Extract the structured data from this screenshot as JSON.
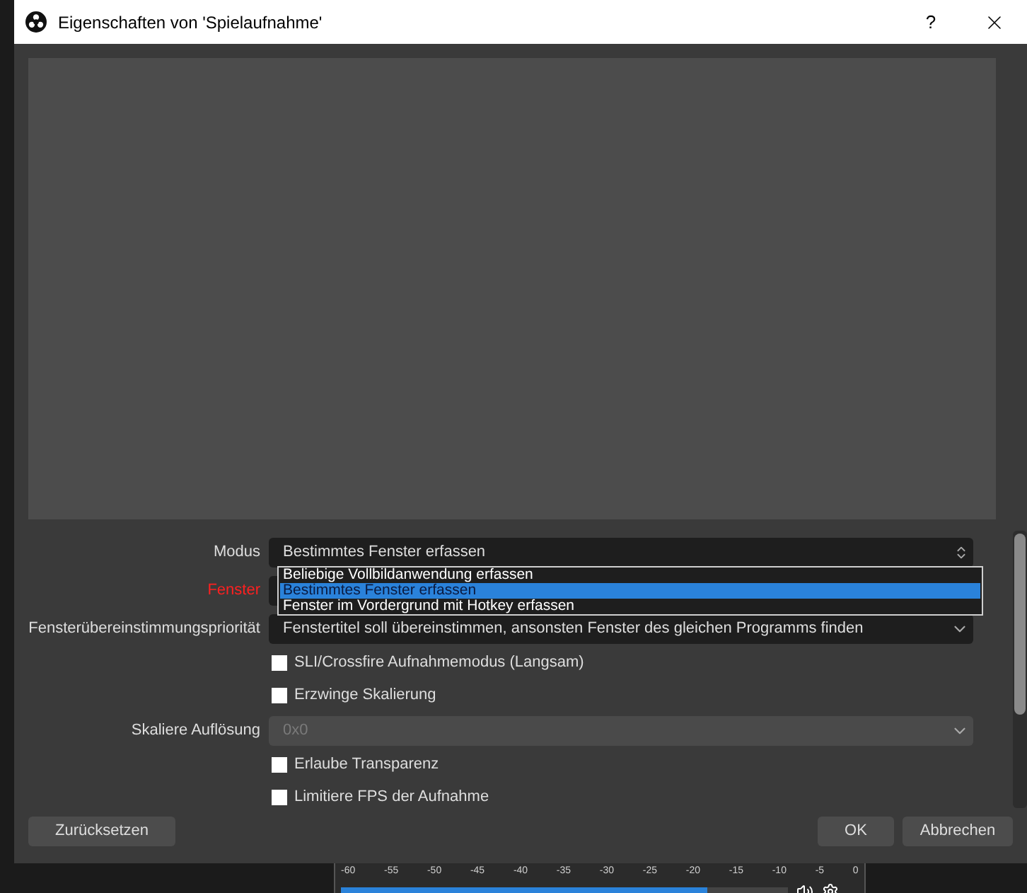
{
  "window": {
    "title": "Eigenschaften von 'Spielaufnahme'",
    "help": "?"
  },
  "form": {
    "rows": [
      {
        "kind": "combo",
        "label": "Modus",
        "value": "Bestimmtes Fenster erfassen",
        "open": true,
        "options": [
          {
            "label": "Beliebige Vollbildanwendung erfassen",
            "selected": false
          },
          {
            "label": "Bestimmtes Fenster erfassen",
            "selected": true
          },
          {
            "label": "Fenster im Vordergrund mit Hotkey erfassen",
            "selected": false
          }
        ]
      },
      {
        "kind": "select",
        "label": "Fenster",
        "invalid": true
      },
      {
        "kind": "select",
        "label": "Fensterübereinstimmungspriorität",
        "value": "Fenstertitel soll übereinstimmen, ansonsten Fenster des gleichen Programms finden"
      },
      {
        "kind": "checkbox",
        "label": "SLI/Crossfire Aufnahmemodus (Langsam)",
        "checked": false
      },
      {
        "kind": "checkbox",
        "label": "Erzwinge Skalierung",
        "checked": false
      },
      {
        "kind": "select",
        "label": "Skaliere Auflösung",
        "value": "0x0",
        "disabled": true
      },
      {
        "kind": "checkbox",
        "label": "Erlaube Transparenz",
        "checked": false
      },
      {
        "kind": "checkbox",
        "label": "Limitiere FPS der Aufnahme",
        "checked": false
      }
    ]
  },
  "buttons": [
    {
      "label": "Zurücksetzen"
    },
    {
      "label": "OK"
    },
    {
      "label": "Abbrechen"
    }
  ],
  "background": {
    "meter_ticks": [
      "-60",
      "-55",
      "-50",
      "-45",
      "-40",
      "-35",
      "-30",
      "-25",
      "-20",
      "-15",
      "-10",
      "-5",
      "0"
    ],
    "volume": {
      "level": 0.82
    }
  }
}
